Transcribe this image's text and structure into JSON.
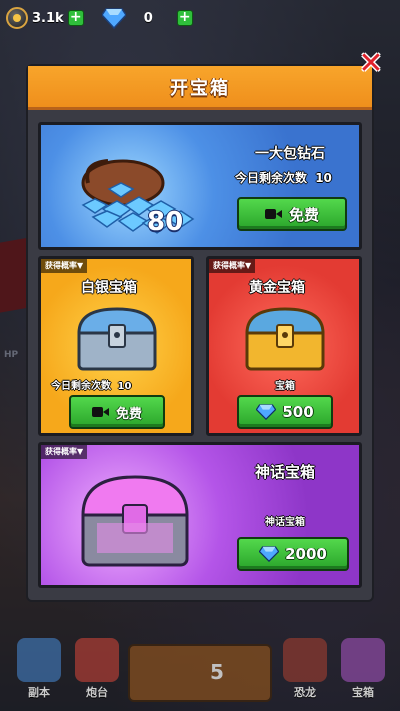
{
  "topbar": {
    "coins": "3.1k",
    "gems": "0"
  },
  "modal": {
    "title": "开宝箱",
    "close_icon": "close-x-icon"
  },
  "diamond_card": {
    "name": "一大包钻石",
    "remaining_label": "今日剩余次数",
    "remaining_count": "10",
    "amount": "80",
    "button_label": "免费"
  },
  "silver_card": {
    "rate_tag": "获得概率▼",
    "name": "白银宝箱",
    "remaining_label": "今日剩余次数",
    "remaining_count": "10",
    "button_label": "免费"
  },
  "gold_card": {
    "rate_tag": "获得概率▼",
    "name": "黄金宝箱",
    "sub_label": "宝箱",
    "price": "500"
  },
  "mythic_card": {
    "rate_tag": "获得概率▼",
    "name": "神话宝箱",
    "sub_label": "神话宝箱",
    "price": "2000"
  },
  "bottom_nav": {
    "items": [
      {
        "label": "副本"
      },
      {
        "label": "炮台"
      },
      {
        "label": "恐龙"
      },
      {
        "label": "宝箱"
      }
    ],
    "center_value": "5"
  },
  "background": {
    "left_label": "HP"
  },
  "colors": {
    "header_orange": "#f39a22",
    "diamond_blue": "#4d90e6",
    "silver_orange": "#f6a81b",
    "gold_red": "#e33b33",
    "mythic_purple": "#b455e8",
    "button_green": "#2aa52b"
  }
}
